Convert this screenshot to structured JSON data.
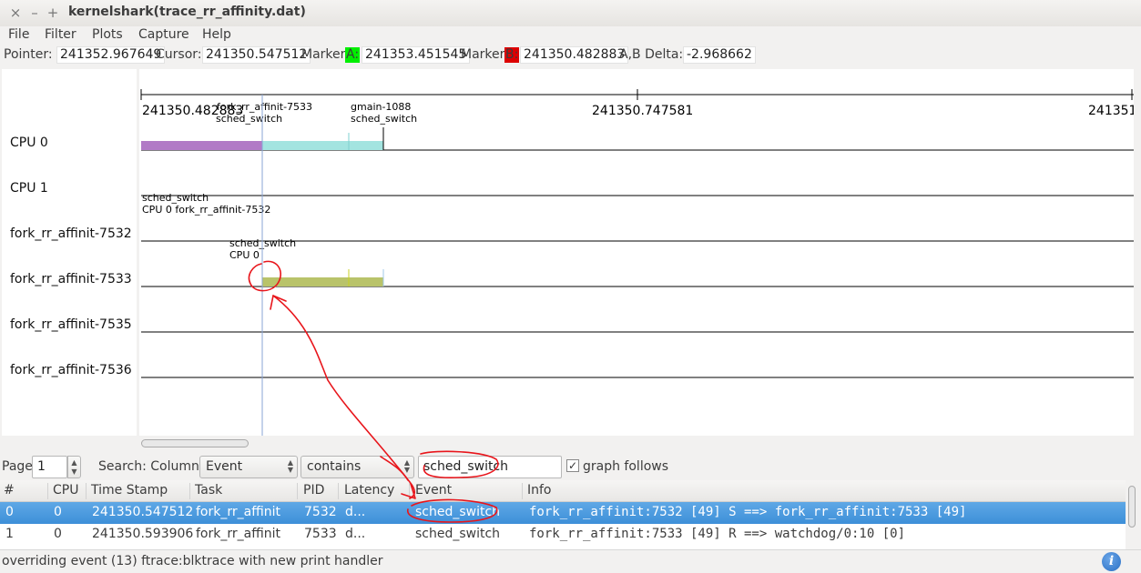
{
  "window": {
    "title": "kernelshark(trace_rr_affinity.dat)",
    "close_glyph": "×",
    "min_glyph": "–",
    "max_glyph": "+"
  },
  "menu": [
    "File",
    "Filter",
    "Plots",
    "Capture",
    "Help"
  ],
  "info": {
    "pointer_label": "Pointer:",
    "pointer_value": "241352.967649",
    "cursor_label": "Cursor:",
    "cursor_value": "241350.547512",
    "marker_a_label": "Marker",
    "marker_a_tag": "A:",
    "marker_a_value": "241353.451545",
    "marker_b_label": "Marker",
    "marker_b_tag": "B:",
    "marker_b_value": "241350.482883",
    "delta_label": "A,B Delta:",
    "delta_value": "-2.968662",
    "marker_a_color": "#00ee00",
    "marker_b_color": "#dd0000"
  },
  "plots": {
    "labels": [
      "CPU 0",
      "CPU 1",
      "fork_rr_affinit-7532",
      "fork_rr_affinit-7533",
      "fork_rr_affinit-7535",
      "fork_rr_affinit-7536"
    ],
    "time_labels": [
      "241350.482883",
      "241350.747581",
      "241351."
    ],
    "annotations": {
      "a1_line1": "fork_rr_affinit-7533",
      "a1_line2": "sched_switch",
      "a2_line1": "gmain-1088",
      "a2_line2": "sched_switch",
      "a3_line1": "sched_switch",
      "a3_line2": "CPU 0 fork_rr_affinit-7532",
      "a4_line1": "sched_switch",
      "a4_line2": "CPU 0"
    },
    "colors": {
      "cpu0_task_a": "#b17ac6",
      "cpu0_task_b": "#a3e4e0",
      "task_7533": "#b9c36a",
      "cursor_line": "#8aa6d6"
    }
  },
  "search": {
    "page_label": "Page",
    "page_value": "1",
    "search_label": "Search: Column:",
    "column_value": "Event",
    "match_value": "contains",
    "query_value": "sched_switch",
    "graph_follows_label": "graph follows",
    "graph_follows_checked": "✓"
  },
  "table": {
    "headers": [
      "#",
      "CPU",
      "Time Stamp",
      "Task",
      "PID",
      "Latency",
      "Event",
      "Info"
    ],
    "rows": [
      {
        "n": "0",
        "cpu": "0",
        "ts": "241350.547512",
        "task": "fork_rr_affinit",
        "pid": "7532",
        "lat": "d...",
        "event": "sched_switch",
        "info": "fork_rr_affinit:7532 [49] S ==> fork_rr_affinit:7533 [49]"
      },
      {
        "n": "1",
        "cpu": "0",
        "ts": "241350.593906",
        "task": "fork_rr_affinit",
        "pid": "7533",
        "lat": "d...",
        "event": "sched_switch",
        "info": "fork_rr_affinit:7533 [49] R ==> watchdog/0:10 [0]"
      }
    ],
    "selected_color": "#4a98de"
  },
  "status": {
    "text": "overriding event (13) ftrace:blktrace with new print handler",
    "info_glyph": "i"
  }
}
